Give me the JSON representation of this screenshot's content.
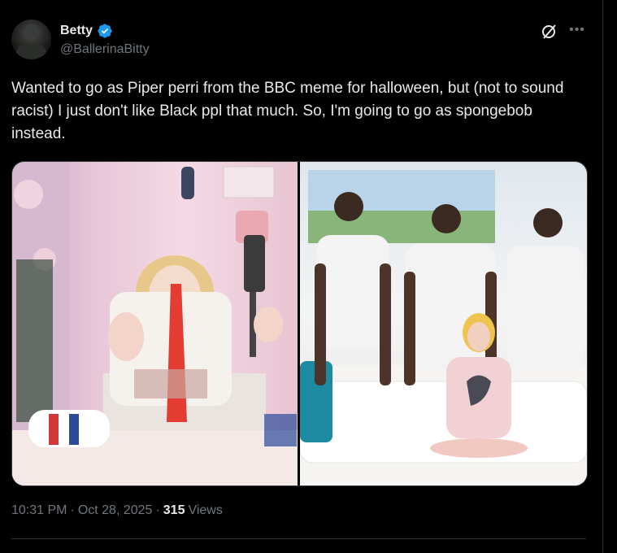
{
  "author": {
    "name": "Betty",
    "handle": "@BallerinaBitty",
    "verified_color": "#1d9bf0"
  },
  "tweet": {
    "text": "Wanted to go as Piper perri from the BBC meme for halloween, but (not to sound racist) I just don't like Black ppl that much. So, I'm going to go as spongebob instead."
  },
  "meta": {
    "time": "10:31 PM",
    "separator": "·",
    "date": "Oct 28, 2025",
    "views_count": "315",
    "views_label": "Views"
  },
  "icons": {
    "grok": "grok-icon",
    "more": "more-icon",
    "verified": "verified-badge-icon"
  },
  "colors": {
    "background": "#000000",
    "text": "#e7e9ea",
    "secondary": "#71767b",
    "border": "#2f3336"
  }
}
